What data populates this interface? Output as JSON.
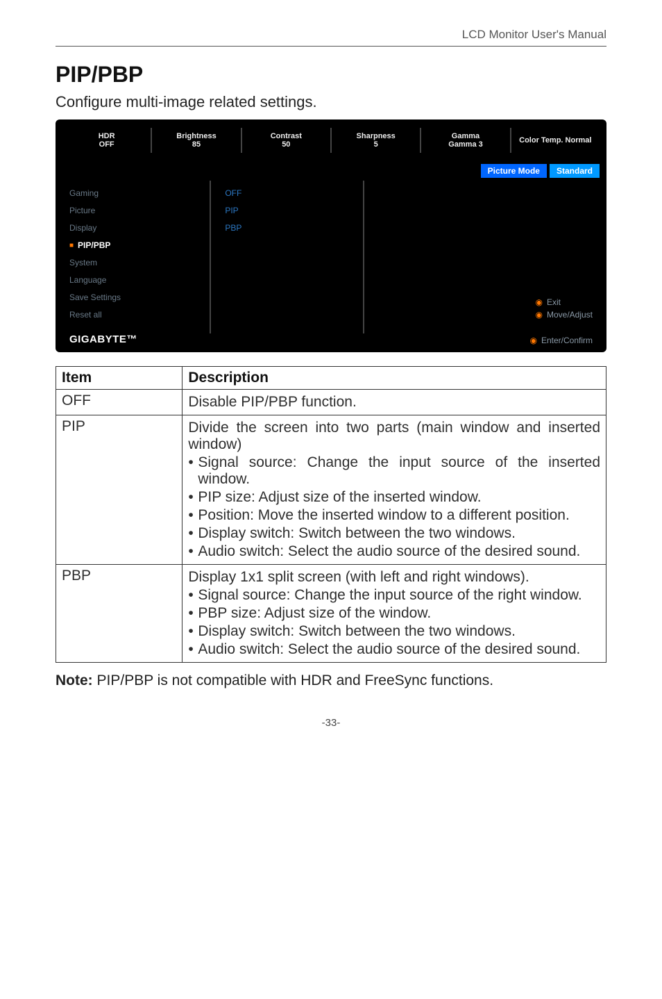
{
  "header": {
    "manual_title": "LCD Monitor User's Manual"
  },
  "section": {
    "title": "PIP/PBP",
    "subtitle": "Configure multi-image related settings."
  },
  "osd": {
    "stats": [
      {
        "label": "HDR",
        "value": "OFF"
      },
      {
        "label": "Brightness",
        "value": "85"
      },
      {
        "label": "Contrast",
        "value": "50"
      },
      {
        "label": "Sharpness",
        "value": "5"
      },
      {
        "label": "Gamma",
        "value": "Gamma 3"
      },
      {
        "label": "Color Temp. Normal",
        "value": ""
      }
    ],
    "picture_mode_label": "Picture Mode",
    "picture_mode_value": "Standard",
    "menu": [
      "Gaming",
      "Picture",
      "Display",
      "PIP/PBP",
      "System",
      "Language",
      "Save Settings",
      "Reset all"
    ],
    "menu_active_index": 3,
    "submenu": [
      "OFF",
      "PIP",
      "PBP"
    ],
    "hints": {
      "exit": "Exit",
      "move": "Move/Adjust",
      "enter": "Enter/Confirm"
    },
    "brand": "GIGABYTE™"
  },
  "table": {
    "head_item": "Item",
    "head_desc": "Description",
    "rows": [
      {
        "item": "OFF",
        "paras": [
          "Disable PIP/PBP function."
        ],
        "bullets": []
      },
      {
        "item": "PIP",
        "paras": [
          "Divide the screen into two parts (main window and inserted window)"
        ],
        "bullets": [
          "Signal source: Change the input source of the inserted window.",
          "PIP size: Adjust size of the inserted window.",
          "Position: Move the inserted window to a different position.",
          "Display switch: Switch between the two windows.",
          "Audio switch: Select the audio source of the desired sound."
        ]
      },
      {
        "item": "PBP",
        "paras": [
          "Display 1x1 split screen (with left and right windows)."
        ],
        "bullets": [
          "Signal source: Change the input source of the right window.",
          "PBP size: Adjust size of the window.",
          "Display switch: Switch between the two windows.",
          "Audio switch: Select the audio source of the desired sound."
        ]
      }
    ]
  },
  "note": {
    "bold": "Note:",
    "text": " PIP/PBP is not compatible with HDR and FreeSync functions."
  },
  "page_number": "-33-",
  "chart_data": {
    "type": "table",
    "title": "PIP/PBP menu options",
    "columns": [
      "Item",
      "Description"
    ],
    "rows": [
      [
        "OFF",
        "Disable PIP/PBP function."
      ],
      [
        "PIP",
        "Divide the screen into two parts (main window and inserted window). Signal source: Change the input source of the inserted window. PIP size: Adjust size of the inserted window. Position: Move the inserted window to a different position. Display switch: Switch between the two windows. Audio switch: Select the audio source of the desired sound."
      ],
      [
        "PBP",
        "Display 1x1 split screen (with left and right windows). Signal source: Change the input source of the right window. PBP size: Adjust size of the window. Display switch: Switch between the two windows. Audio switch: Select the audio source of the desired sound."
      ]
    ]
  }
}
